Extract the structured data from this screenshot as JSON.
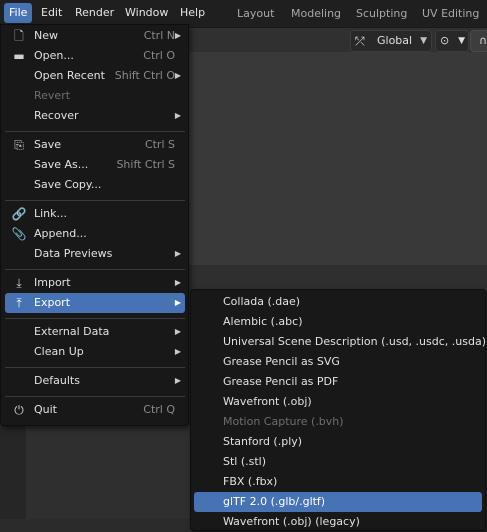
{
  "menubar": {
    "items": [
      {
        "label": "File",
        "active": true
      },
      {
        "label": "Edit"
      },
      {
        "label": "Render"
      },
      {
        "label": "Window"
      },
      {
        "label": "Help"
      }
    ],
    "workspaces": [
      "Layout",
      "Modeling",
      "Sculpting",
      "UV Editing"
    ]
  },
  "viewport_header": {
    "transform_orientation": "Global"
  },
  "file_menu": {
    "new": {
      "label": "New",
      "shortcut": "Ctrl N"
    },
    "open": {
      "label": "Open...",
      "shortcut": "Ctrl O"
    },
    "open_recent": {
      "label": "Open Recent",
      "shortcut": "Shift Ctrl O"
    },
    "revert": {
      "label": "Revert"
    },
    "recover": {
      "label": "Recover"
    },
    "save": {
      "label": "Save",
      "shortcut": "Ctrl S"
    },
    "save_as": {
      "label": "Save As...",
      "shortcut": "Shift Ctrl S"
    },
    "save_copy": {
      "label": "Save Copy..."
    },
    "link": {
      "label": "Link..."
    },
    "append": {
      "label": "Append..."
    },
    "data_previews": {
      "label": "Data Previews"
    },
    "import": {
      "label": "Import"
    },
    "export": {
      "label": "Export"
    },
    "external_data": {
      "label": "External Data"
    },
    "clean_up": {
      "label": "Clean Up"
    },
    "defaults": {
      "label": "Defaults"
    },
    "quit": {
      "label": "Quit",
      "shortcut": "Ctrl Q"
    }
  },
  "export_menu": {
    "items": [
      {
        "label": "Collada (.dae)"
      },
      {
        "label": "Alembic (.abc)"
      },
      {
        "label": "Universal Scene Description (.usd, .usdc, .usda)"
      },
      {
        "label": "Grease Pencil as SVG"
      },
      {
        "label": "Grease Pencil as PDF"
      },
      {
        "label": "Wavefront (.obj)"
      },
      {
        "label": "Motion Capture (.bvh)",
        "disabled": true
      },
      {
        "label": "Stanford (.ply)"
      },
      {
        "label": "Stl (.stl)"
      },
      {
        "label": "FBX (.fbx)"
      },
      {
        "label": "glTF 2.0 (.glb/.gltf)",
        "highlight": true
      },
      {
        "label": "Wavefront (.obj) (legacy)"
      }
    ]
  },
  "colors": {
    "accent": "#4772b3",
    "menu_bg": "#181818",
    "topbar_bg": "#1f1f1f"
  }
}
